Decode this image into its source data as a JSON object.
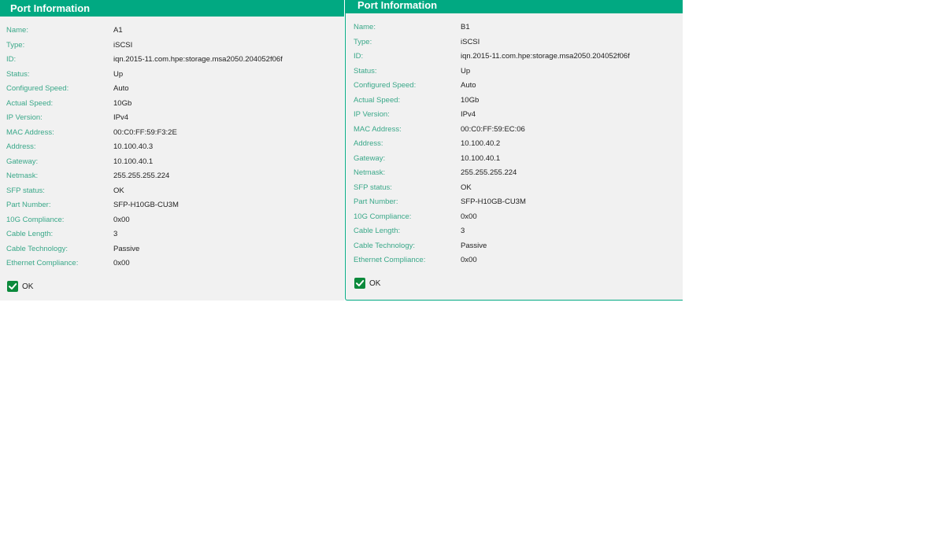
{
  "panels": [
    {
      "title": "Port Information",
      "fields": [
        {
          "label": "Name:",
          "value": "A1"
        },
        {
          "label": "Type:",
          "value": "iSCSI"
        },
        {
          "label": "ID:",
          "value": "iqn.2015-11.com.hpe:storage.msa2050.204052f06f"
        },
        {
          "label": "Status:",
          "value": "Up"
        },
        {
          "label": "Configured Speed:",
          "value": "Auto"
        },
        {
          "label": "Actual Speed:",
          "value": "10Gb"
        },
        {
          "label": "IP Version:",
          "value": "IPv4"
        },
        {
          "label": "MAC Address:",
          "value": "00:C0:FF:59:F3:2E"
        },
        {
          "label": "Address:",
          "value": "10.100.40.3"
        },
        {
          "label": "Gateway:",
          "value": "10.100.40.1"
        },
        {
          "label": "Netmask:",
          "value": "255.255.255.224"
        },
        {
          "label": "SFP status:",
          "value": "OK"
        },
        {
          "label": "Part Number:",
          "value": "SFP-H10GB-CU3M"
        },
        {
          "label": "10G Compliance:",
          "value": "0x00"
        },
        {
          "label": "Cable Length:",
          "value": "3"
        },
        {
          "label": "Cable Technology:",
          "value": "Passive"
        },
        {
          "label": "Ethernet Compliance:",
          "value": "0x00"
        }
      ],
      "status": {
        "label": "OK",
        "icon": "check-icon",
        "color": "#0c8a3c"
      }
    },
    {
      "title": "Port Information",
      "fields": [
        {
          "label": "Name:",
          "value": "B1"
        },
        {
          "label": "Type:",
          "value": "iSCSI"
        },
        {
          "label": "ID:",
          "value": "iqn.2015-11.com.hpe:storage.msa2050.204052f06f"
        },
        {
          "label": "Status:",
          "value": "Up"
        },
        {
          "label": "Configured Speed:",
          "value": "Auto"
        },
        {
          "label": "Actual Speed:",
          "value": "10Gb"
        },
        {
          "label": "IP Version:",
          "value": "IPv4"
        },
        {
          "label": "MAC Address:",
          "value": "00:C0:FF:59:EC:06"
        },
        {
          "label": "Address:",
          "value": "10.100.40.2"
        },
        {
          "label": "Gateway:",
          "value": "10.100.40.1"
        },
        {
          "label": "Netmask:",
          "value": "255.255.255.224"
        },
        {
          "label": "SFP status:",
          "value": "OK"
        },
        {
          "label": "Part Number:",
          "value": "SFP-H10GB-CU3M"
        },
        {
          "label": "10G Compliance:",
          "value": "0x00"
        },
        {
          "label": "Cable Length:",
          "value": "3"
        },
        {
          "label": "Cable Technology:",
          "value": "Passive"
        },
        {
          "label": "Ethernet Compliance:",
          "value": "0x00"
        }
      ],
      "status": {
        "label": "OK",
        "icon": "check-icon",
        "color": "#0c8a3c"
      }
    }
  ],
  "colors": {
    "header": "#01a982",
    "label": "#3aa889",
    "panel_bg": "#f1f1f1"
  }
}
